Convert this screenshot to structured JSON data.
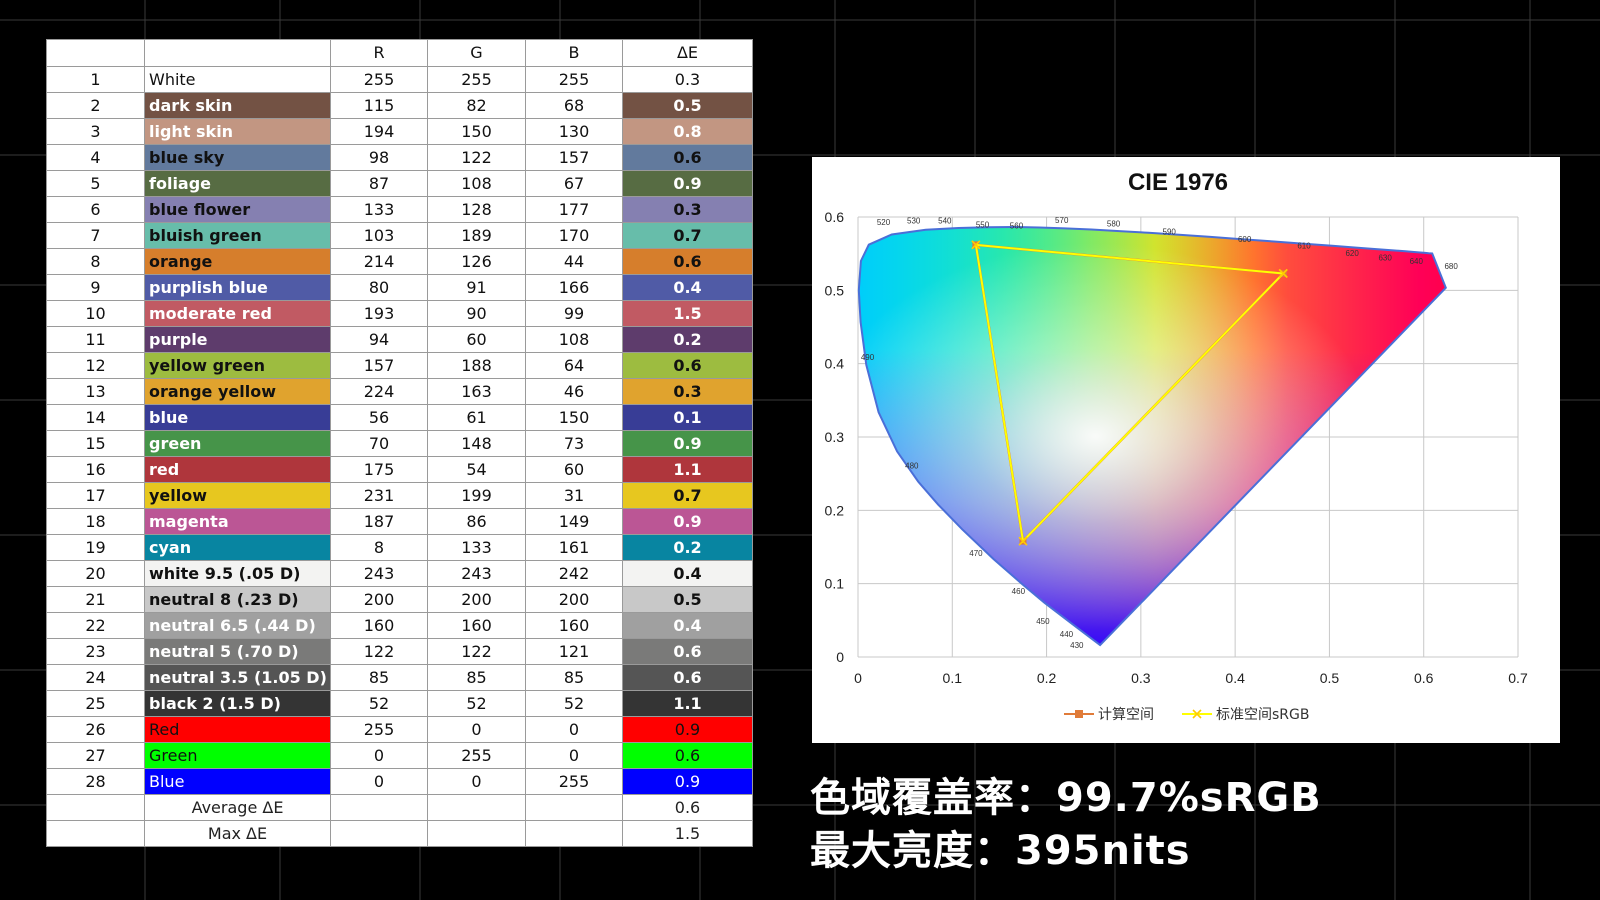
{
  "table": {
    "headers": [
      "",
      "",
      "R",
      "G",
      "B",
      "ΔE"
    ],
    "rows": [
      {
        "idx": "1",
        "name": "White",
        "r": "255",
        "g": "255",
        "b": "255",
        "de": "0.3",
        "color": "#ffffff",
        "text": "#111111"
      },
      {
        "idx": "2",
        "name": "dark skin",
        "r": "115",
        "g": "82",
        "b": "68",
        "de": "0.5",
        "color": "#735244",
        "text": "#ffffff"
      },
      {
        "idx": "3",
        "name": "light skin",
        "r": "194",
        "g": "150",
        "b": "130",
        "de": "0.8",
        "color": "#c29682",
        "text": "#ffffff"
      },
      {
        "idx": "4",
        "name": "blue sky",
        "r": "98",
        "g": "122",
        "b": "157",
        "de": "0.6",
        "color": "#627a9d",
        "text": "#111111"
      },
      {
        "idx": "5",
        "name": "foliage",
        "r": "87",
        "g": "108",
        "b": "67",
        "de": "0.9",
        "color": "#576c43",
        "text": "#ffffff"
      },
      {
        "idx": "6",
        "name": "blue flower",
        "r": "133",
        "g": "128",
        "b": "177",
        "de": "0.3",
        "color": "#8580b1",
        "text": "#111111"
      },
      {
        "idx": "7",
        "name": "bluish green",
        "r": "103",
        "g": "189",
        "b": "170",
        "de": "0.7",
        "color": "#67bdaa",
        "text": "#111111"
      },
      {
        "idx": "8",
        "name": "orange",
        "r": "214",
        "g": "126",
        "b": "44",
        "de": "0.6",
        "color": "#d67e2c",
        "text": "#111111"
      },
      {
        "idx": "9",
        "name": "purplish blue",
        "r": "80",
        "g": "91",
        "b": "166",
        "de": "0.4",
        "color": "#505ba6",
        "text": "#ffffff"
      },
      {
        "idx": "10",
        "name": "moderate red",
        "r": "193",
        "g": "90",
        "b": "99",
        "de": "1.5",
        "color": "#c15a63",
        "text": "#ffffff"
      },
      {
        "idx": "11",
        "name": "purple",
        "r": "94",
        "g": "60",
        "b": "108",
        "de": "0.2",
        "color": "#5e3c6c",
        "text": "#ffffff"
      },
      {
        "idx": "12",
        "name": "yellow green",
        "r": "157",
        "g": "188",
        "b": "64",
        "de": "0.6",
        "color": "#9dbc40",
        "text": "#111111"
      },
      {
        "idx": "13",
        "name": "orange yellow",
        "r": "224",
        "g": "163",
        "b": "46",
        "de": "0.3",
        "color": "#e0a32e",
        "text": "#111111"
      },
      {
        "idx": "14",
        "name": "blue",
        "r": "56",
        "g": "61",
        "b": "150",
        "de": "0.1",
        "color": "#383d96",
        "text": "#ffffff"
      },
      {
        "idx": "15",
        "name": "green",
        "r": "70",
        "g": "148",
        "b": "73",
        "de": "0.9",
        "color": "#469449",
        "text": "#ffffff"
      },
      {
        "idx": "16",
        "name": "red",
        "r": "175",
        "g": "54",
        "b": "60",
        "de": "1.1",
        "color": "#af363c",
        "text": "#ffffff"
      },
      {
        "idx": "17",
        "name": "yellow",
        "r": "231",
        "g": "199",
        "b": "31",
        "de": "0.7",
        "color": "#e7c71f",
        "text": "#111111"
      },
      {
        "idx": "18",
        "name": "magenta",
        "r": "187",
        "g": "86",
        "b": "149",
        "de": "0.9",
        "color": "#bb5695",
        "text": "#ffffff"
      },
      {
        "idx": "19",
        "name": "cyan",
        "r": "8",
        "g": "133",
        "b": "161",
        "de": "0.2",
        "color": "#0885a1",
        "text": "#ffffff"
      },
      {
        "idx": "20",
        "name": "white 9.5 (.05 D)",
        "r": "243",
        "g": "243",
        "b": "242",
        "de": "0.4",
        "color": "#f3f3f2",
        "text": "#111111"
      },
      {
        "idx": "21",
        "name": "neutral 8 (.23 D)",
        "r": "200",
        "g": "200",
        "b": "200",
        "de": "0.5",
        "color": "#c8c8c8",
        "text": "#111111"
      },
      {
        "idx": "22",
        "name": "neutral 6.5 (.44 D)",
        "r": "160",
        "g": "160",
        "b": "160",
        "de": "0.4",
        "color": "#a0a0a0",
        "text": "#ffffff"
      },
      {
        "idx": "23",
        "name": "neutral 5 (.70 D)",
        "r": "122",
        "g": "122",
        "b": "121",
        "de": "0.6",
        "color": "#7a7a79",
        "text": "#ffffff"
      },
      {
        "idx": "24",
        "name": "neutral 3.5 (1.05 D)",
        "r": "85",
        "g": "85",
        "b": "85",
        "de": "0.6",
        "color": "#555555",
        "text": "#ffffff"
      },
      {
        "idx": "25",
        "name": "black 2 (1.5 D)",
        "r": "52",
        "g": "52",
        "b": "52",
        "de": "1.1",
        "color": "#343434",
        "text": "#ffffff"
      },
      {
        "idx": "26",
        "name": "Red",
        "r": "255",
        "g": "0",
        "b": "0",
        "de": "0.9",
        "color": "#ff0000",
        "text": "#111111"
      },
      {
        "idx": "27",
        "name": "Green",
        "r": "0",
        "g": "255",
        "b": "0",
        "de": "0.6",
        "color": "#00ff00",
        "text": "#111111"
      },
      {
        "idx": "28",
        "name": "Blue",
        "r": "0",
        "g": "0",
        "b": "255",
        "de": "0.9",
        "color": "#0000ff",
        "text": "#ffffff"
      }
    ],
    "footer": [
      {
        "label": "Average ΔE",
        "value": "0.6"
      },
      {
        "label": "Max ΔE",
        "value": "1.5"
      }
    ]
  },
  "chart_data": {
    "type": "scatter",
    "title": "CIE 1976",
    "xlabel": "",
    "ylabel": "",
    "xlim": [
      0,
      0.7
    ],
    "ylim": [
      0,
      0.6
    ],
    "xticks": [
      "0",
      "0.1",
      "0.2",
      "0.3",
      "0.4",
      "0.5",
      "0.6",
      "0.7"
    ],
    "yticks": [
      "0",
      "0.1",
      "0.2",
      "0.3",
      "0.4",
      "0.5",
      "0.6"
    ],
    "grid": true,
    "legend_position": "bottom",
    "series": [
      {
        "name": "计算空间",
        "color": "#e07b39",
        "x": [
          0.451,
          0.125,
          0.175,
          0.451
        ],
        "y": [
          0.523,
          0.562,
          0.158,
          0.523
        ]
      },
      {
        "name": "标准空间sRGB",
        "color": "#ffff00",
        "x": [
          0.451,
          0.125,
          0.175,
          0.451
        ],
        "y": [
          0.523,
          0.562,
          0.158,
          0.523
        ]
      }
    ],
    "locus": {
      "u": [
        0.2568,
        0.2266,
        0.1977,
        0.1745,
        0.1438,
        0.1105,
        0.0849,
        0.0638,
        0.0415,
        0.0218,
        0.0088,
        0.0028,
        0.0008,
        0.0031,
        0.0115,
        0.0357,
        0.0718,
        0.1065,
        0.1375,
        0.1655,
        0.1924,
        0.2195,
        0.2477,
        0.2771,
        0.3081,
        0.3406,
        0.3739,
        0.4074,
        0.4411,
        0.4731,
        0.5029,
        0.5283,
        0.5496,
        0.5675,
        0.5807,
        0.5898,
        0.5964,
        0.6016,
        0.6053,
        0.609,
        0.6234
      ],
      "v": [
        0.0162,
        0.0456,
        0.074,
        0.099,
        0.1335,
        0.1741,
        0.2081,
        0.2392,
        0.2804,
        0.3337,
        0.3983,
        0.4567,
        0.5,
        0.54,
        0.5622,
        0.5762,
        0.5825,
        0.585,
        0.5861,
        0.5863,
        0.5857,
        0.5845,
        0.5829,
        0.5808,
        0.5784,
        0.5757,
        0.5728,
        0.5697,
        0.5666,
        0.5636,
        0.5607,
        0.5583,
        0.5562,
        0.5545,
        0.5532,
        0.5523,
        0.5516,
        0.5511,
        0.5507,
        0.5504,
        0.5035
      ]
    },
    "wavelength_labels": [
      {
        "text": "430",
        "u": 0.225,
        "v": 0.012
      },
      {
        "text": "440",
        "u": 0.214,
        "v": 0.027
      },
      {
        "text": "450",
        "u": 0.189,
        "v": 0.045
      },
      {
        "text": "460",
        "u": 0.163,
        "v": 0.086
      },
      {
        "text": "470",
        "u": 0.118,
        "v": 0.138
      },
      {
        "text": "480",
        "u": 0.05,
        "v": 0.257
      },
      {
        "text": "490",
        "u": 0.003,
        "v": 0.405
      },
      {
        "text": "520",
        "u": 0.02,
        "v": 0.589
      },
      {
        "text": "530",
        "u": 0.052,
        "v": 0.591
      },
      {
        "text": "540",
        "u": 0.085,
        "v": 0.591
      },
      {
        "text": "550",
        "u": 0.125,
        "v": 0.586
      },
      {
        "text": "560",
        "u": 0.161,
        "v": 0.584
      },
      {
        "text": "570",
        "u": 0.209,
        "v": 0.592
      },
      {
        "text": "580",
        "u": 0.264,
        "v": 0.587
      },
      {
        "text": "590",
        "u": 0.323,
        "v": 0.576
      },
      {
        "text": "600",
        "u": 0.403,
        "v": 0.566
      },
      {
        "text": "610",
        "u": 0.466,
        "v": 0.557
      },
      {
        "text": "620",
        "u": 0.517,
        "v": 0.547
      },
      {
        "text": "630",
        "u": 0.552,
        "v": 0.541
      },
      {
        "text": "640",
        "u": 0.585,
        "v": 0.536
      },
      {
        "text": "680",
        "u": 0.622,
        "v": 0.529
      }
    ]
  },
  "stats": {
    "gamut": "色域覆盖率：99.7%sRGB",
    "brightness": "最大亮度：395nits"
  }
}
